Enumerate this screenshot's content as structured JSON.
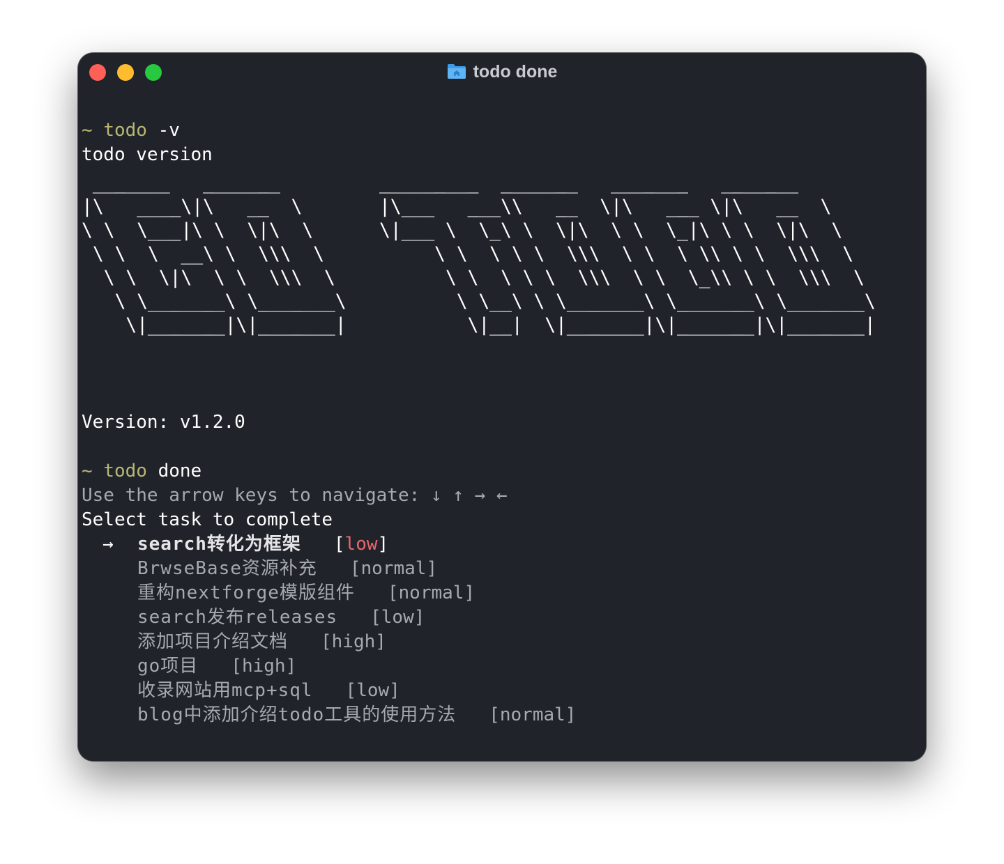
{
  "window": {
    "title": "todo done",
    "icon": "folder-home-icon"
  },
  "session": [
    {
      "prompt": "~",
      "command": "todo",
      "args": "-v",
      "output": "todo version"
    }
  ],
  "banner": " _______   _______         _________  _______   _______   _______\n|\\   ____\\|\\   __  \\       |\\___   ___\\\\   __  \\|\\   ___ \\|\\   __  \\\n\\ \\  \\___|\\ \\  \\|\\  \\      \\|___ \\  \\_\\ \\  \\|\\  \\ \\  \\_|\\ \\ \\  \\|\\  \\\n \\ \\  \\  __\\ \\  \\\\\\  \\          \\ \\  \\ \\ \\  \\\\\\  \\ \\  \\ \\\\ \\ \\  \\\\\\  \\\n  \\ \\  \\|\\  \\ \\  \\\\\\  \\          \\ \\  \\ \\ \\  \\\\\\  \\ \\  \\_\\\\ \\ \\  \\\\\\  \\\n   \\ \\_______\\ \\_______\\          \\ \\__\\ \\ \\_______\\ \\_______\\ \\_______\\\n    \\|_______|\\|_______|           \\|__|  \\|_______|\\|_______|\\|_______|",
  "version_line": "Version: v1.2.0",
  "second_command": {
    "prompt": "~",
    "command": "todo",
    "args": "done"
  },
  "hint": "Use the arrow keys to navigate: ↓ ↑ → ←",
  "select_prompt": "Select task to complete",
  "cursor_glyph": "→",
  "tasks": [
    {
      "name": "search转化为框架",
      "priority_open": "[",
      "priority": "low",
      "priority_close": "]",
      "selected": true
    },
    {
      "name": "BrwseBase资源补充",
      "priority_open": "[",
      "priority": "normal",
      "priority_close": "]",
      "selected": false
    },
    {
      "name": "重构nextforge模版组件",
      "priority_open": "[",
      "priority": "normal",
      "priority_close": "]",
      "selected": false
    },
    {
      "name": "search发布releases",
      "priority_open": "[",
      "priority": "low",
      "priority_close": "]",
      "selected": false
    },
    {
      "name": "添加项目介绍文档",
      "priority_open": "[",
      "priority": "high",
      "priority_close": "]",
      "selected": false
    },
    {
      "name": "go项目",
      "priority_open": "[",
      "priority": "high",
      "priority_close": "]",
      "selected": false
    },
    {
      "name": "收录网站用mcp+sql",
      "priority_open": "[",
      "priority": "low",
      "priority_close": "]",
      "selected": false
    },
    {
      "name": "blog中添加介绍todo工具的使用方法",
      "priority_open": "[",
      "priority": "normal",
      "priority_close": "]",
      "selected": false
    }
  ],
  "colors": {
    "background": "#21232b",
    "prompt": "#b8b873",
    "selected_priority": "#e5686c",
    "dim_text": "#a7a9b0"
  }
}
